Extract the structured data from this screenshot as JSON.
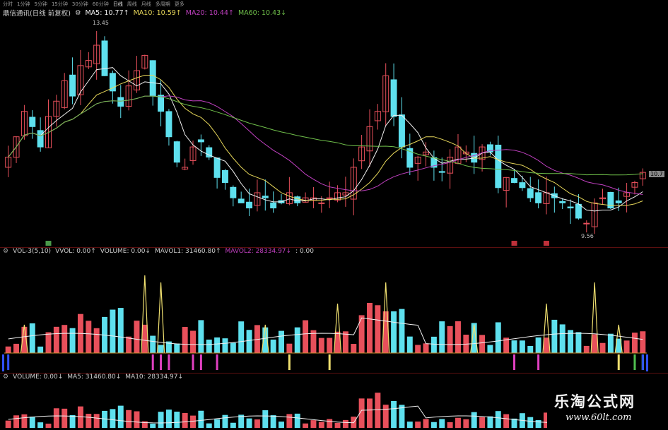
{
  "toolbar": {
    "items": [
      "分时",
      "1分钟",
      "5分钟",
      "15分钟",
      "30分钟",
      "60分钟",
      "日线",
      "周线",
      "月线",
      "多周期",
      "更多"
    ],
    "active_index": 6
  },
  "main_info": {
    "stock": "鼎信通讯(日线 前复权)",
    "ma5": "MA5: 10.77↑",
    "ma10": "MA10: 10.59↑",
    "ma20": "MA20: 10.44↑",
    "ma60": "MA60: 10.43↓"
  },
  "price_labels": {
    "high": "13.45",
    "low": "9.56",
    "current": "10.7"
  },
  "vol_info": {
    "name": "VOL-3(5,10)",
    "vvol": "VVOL: 0.00↑",
    "volume": "VOLUME: 0.00↓",
    "mavol1": "MAVOL1: 31460.80↑",
    "mavol2": "MAVOL2: 28334.97↓",
    "extra": ": 0.00"
  },
  "volume_info": {
    "volume": "VOLUME: 0.00↓",
    "ma5": "MA5: 31460.80↓",
    "ma10": "MA10: 28334.97↓"
  },
  "watermark": {
    "cn": "乐淘公式网",
    "url": "www.60lt.com"
  },
  "colors": {
    "up": "#e8505b",
    "down": "#5ee0ee",
    "ma5": "#f0f0f0",
    "ma10": "#e8d85a",
    "ma20": "#c040c0",
    "ma60": "#6fbf4a",
    "spike": "#f0e070",
    "magenta": "#e040c0",
    "green": "#50c050",
    "blue": "#3050ff"
  },
  "chart_data": {
    "type": "candlestick",
    "ylim": [
      9.3,
      13.7
    ],
    "high": 13.45,
    "low": 9.56,
    "closes": [
      11.0,
      11.4,
      11.9,
      11.6,
      11.2,
      11.8,
      12.1,
      12.5,
      12.2,
      12.8,
      12.9,
      13.2,
      12.6,
      12.3,
      12.0,
      12.4,
      12.7,
      13.0,
      12.2,
      11.9,
      11.4,
      10.9,
      10.8,
      11.2,
      11.3,
      11.0,
      10.6,
      10.5,
      10.2,
      10.1,
      10.0,
      10.3,
      10.2,
      10.0,
      10.1,
      10.3,
      10.1,
      10.2,
      10.2,
      10.1,
      10.2,
      10.3,
      10.3,
      10.8,
      11.2,
      11.6,
      11.9,
      12.6,
      11.8,
      11.2,
      10.8,
      11.0,
      11.1,
      10.8,
      10.7,
      11.0,
      11.2,
      11.1,
      10.9,
      11.2,
      11.1,
      10.4,
      10.6,
      10.5,
      10.4,
      10.2,
      10.1,
      10.3,
      10.2,
      10.1,
      10.0,
      9.8,
      9.7,
      10.1,
      10.2,
      10.0,
      10.1,
      10.3,
      10.5,
      10.7
    ]
  }
}
